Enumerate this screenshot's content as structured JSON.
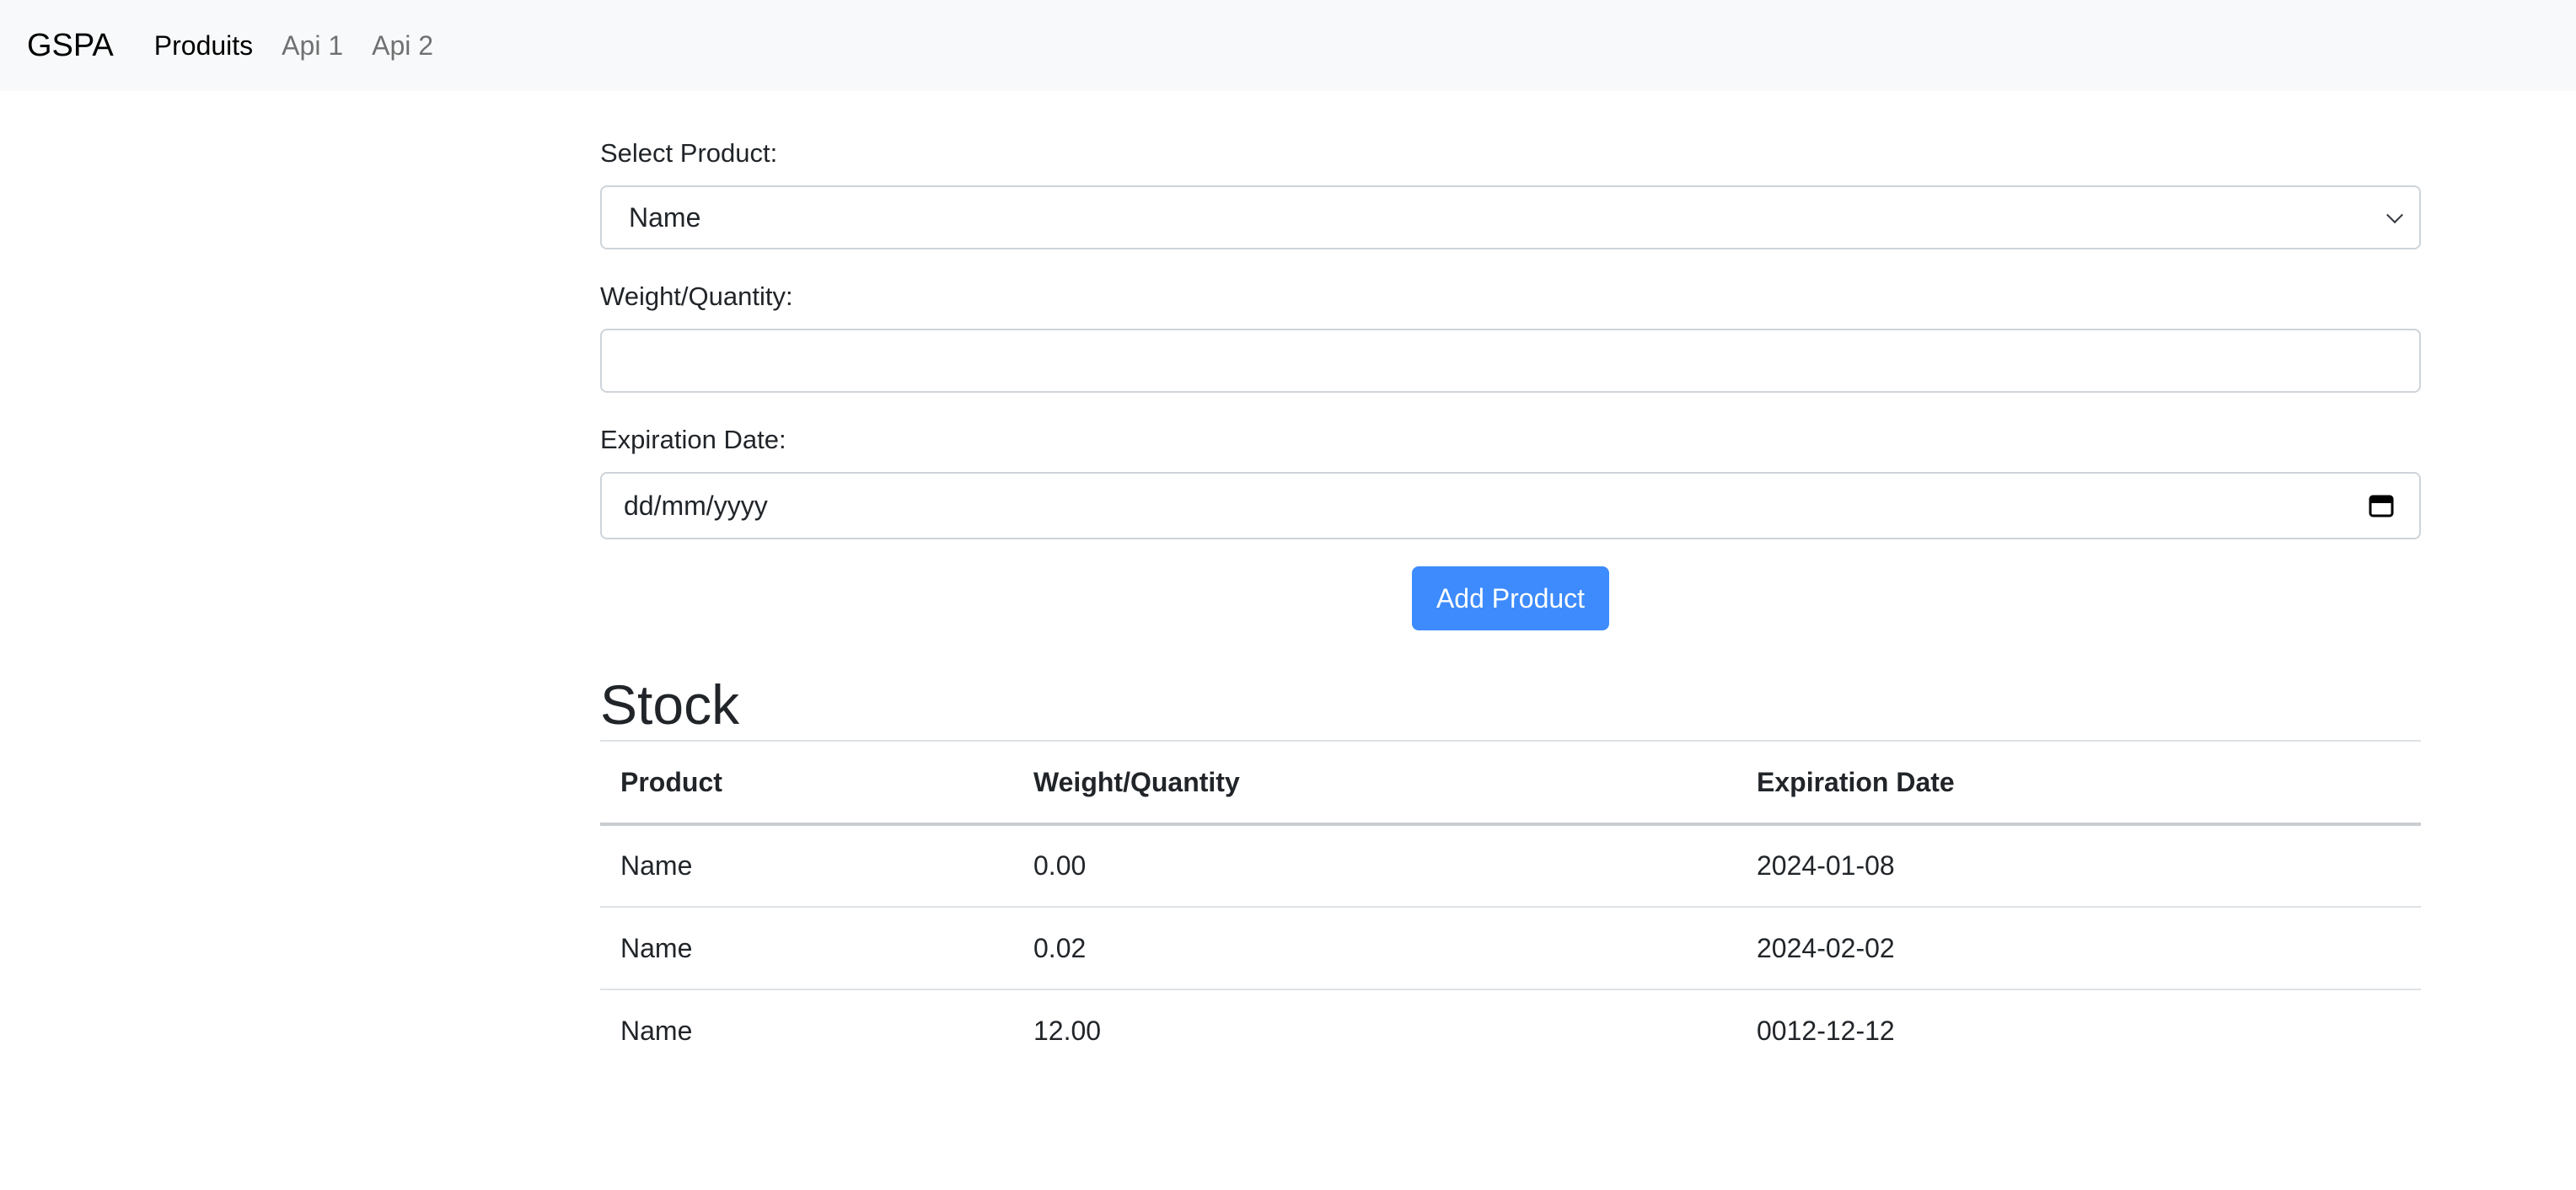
{
  "navbar": {
    "brand": "GSPA",
    "links": [
      {
        "label": "Produits"
      },
      {
        "label": "Api 1"
      },
      {
        "label": "Api 2"
      }
    ]
  },
  "form": {
    "product_label": "Select Product:",
    "product_selected": "Name",
    "weight_label": "Weight/Quantity:",
    "weight_value": "",
    "expiration_label": "Expiration Date:",
    "expiration_placeholder": "dd/mm/yyyy",
    "submit_label": "Add Product"
  },
  "stock": {
    "title": "Stock",
    "columns": [
      "Product",
      "Weight/Quantity",
      "Expiration Date"
    ],
    "rows": [
      [
        "Name",
        "0.00",
        "2024-01-08"
      ],
      [
        "Name",
        "0.02",
        "2024-02-02"
      ],
      [
        "Name",
        "12.00",
        "0012-12-12"
      ]
    ]
  },
  "colors": {
    "navbar_bg": "#f8f9fa",
    "primary": "#3d8bfd",
    "border": "#ced4da"
  }
}
